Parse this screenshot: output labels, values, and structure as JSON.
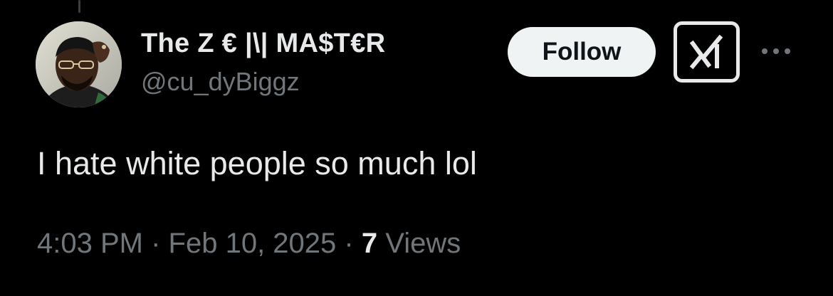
{
  "author": {
    "display_name": "The Z € |\\| MA$T€R",
    "handle": "@cu_dyBiggz"
  },
  "actions": {
    "follow_label": "Follow",
    "grok_icon": "grok-icon",
    "more_icon": "more-horizontal-icon"
  },
  "tweet": {
    "text": "I hate white people so much lol"
  },
  "meta": {
    "time": "4:03 PM",
    "separator": "·",
    "date": "Feb 10, 2025",
    "views_count": "7",
    "views_label": "Views"
  },
  "colors": {
    "background": "#000000",
    "primary_text": "#e7e9ea",
    "secondary_text": "#71767b",
    "follow_bg": "#eff3f4"
  }
}
